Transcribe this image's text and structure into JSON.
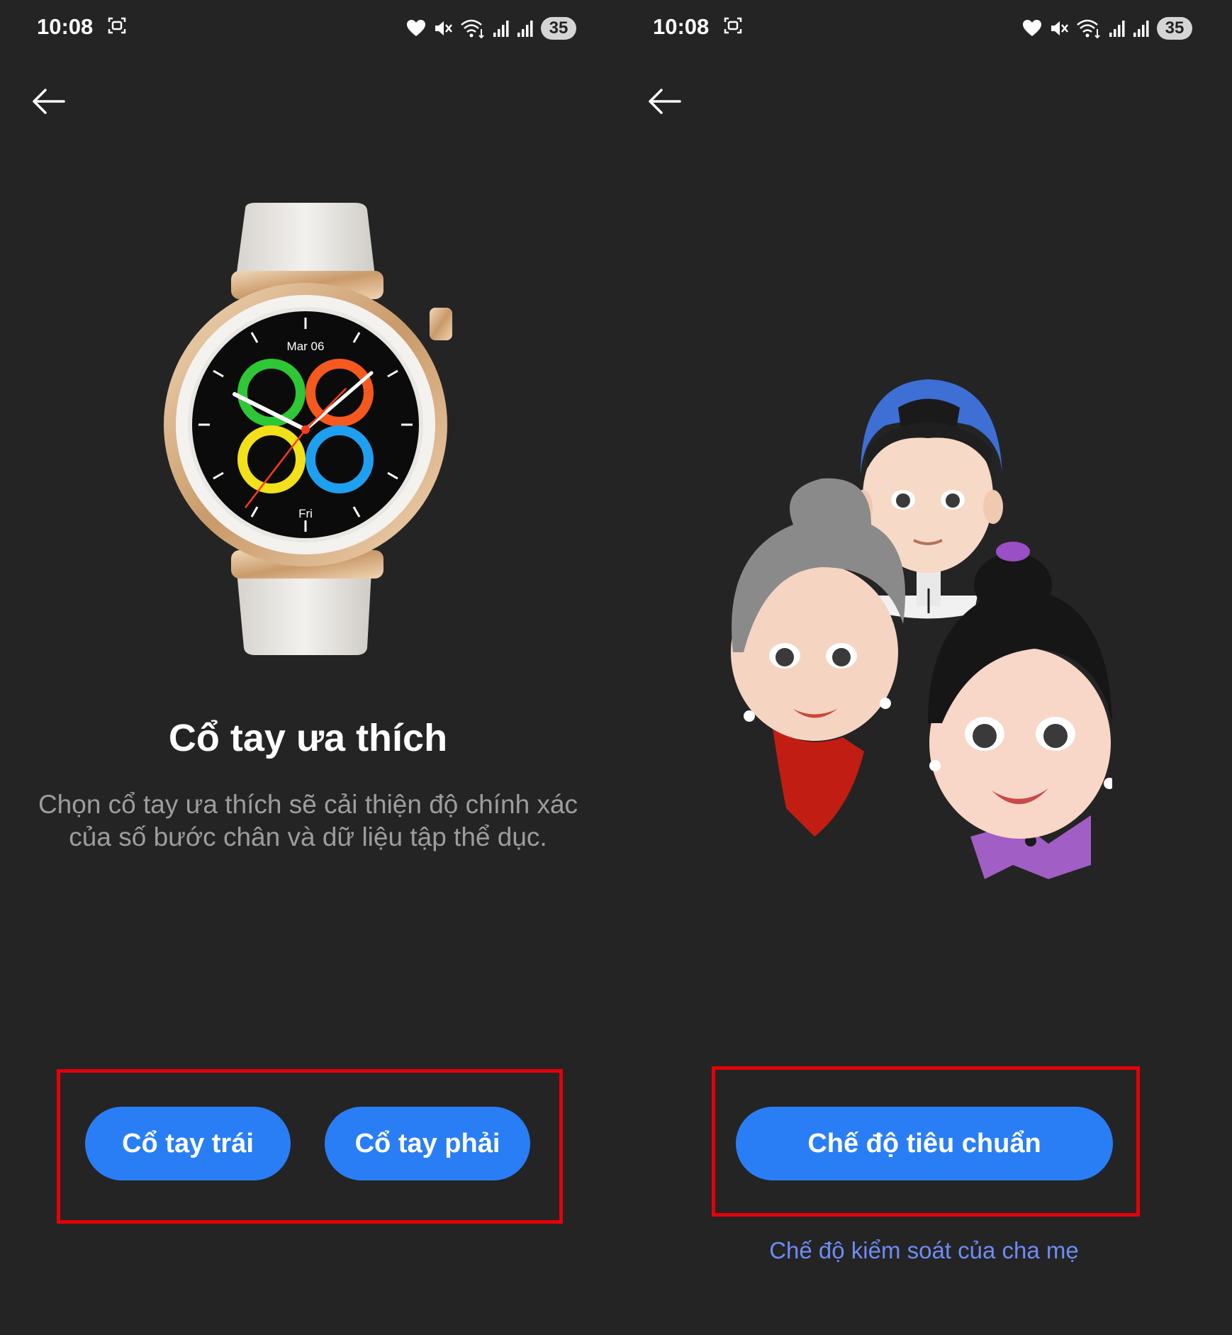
{
  "left_screen": {
    "status_bar": {
      "time": "10:08",
      "icons": [
        "screenshot-icon",
        "heart-icon",
        "mute-icon",
        "wifi-icon",
        "signal-icon",
        "signal-icon"
      ],
      "battery": "35"
    },
    "watch": {
      "date": "Mar 06",
      "day": "Fri",
      "ring_colors": [
        "#2ec735",
        "#f5591e",
        "#f2e01a",
        "#1f9ff0"
      ]
    },
    "title": "Cổ tay ưa thích",
    "subtitle": "Chọn cổ tay ưa thích sẽ cải thiện độ chính xác của số bước chân và dữ liệu tập thể dục.",
    "buttons": {
      "left_wrist": "Cổ tay trái",
      "right_wrist": "Cổ tay phải"
    }
  },
  "right_screen": {
    "status_bar": {
      "time": "10:08",
      "icons": [
        "screenshot-icon",
        "heart-icon",
        "mute-icon",
        "wifi-icon",
        "signal-icon",
        "signal-icon"
      ],
      "battery": "35"
    },
    "buttons": {
      "standard_mode": "Chế độ tiêu chuẩn"
    },
    "parental_link": "Chế độ kiểm soát của cha mẹ"
  },
  "colors": {
    "background": "#242424",
    "primary_button": "#2a7ef5",
    "link": "#6e8cf5",
    "highlight_border": "#e5000a"
  }
}
